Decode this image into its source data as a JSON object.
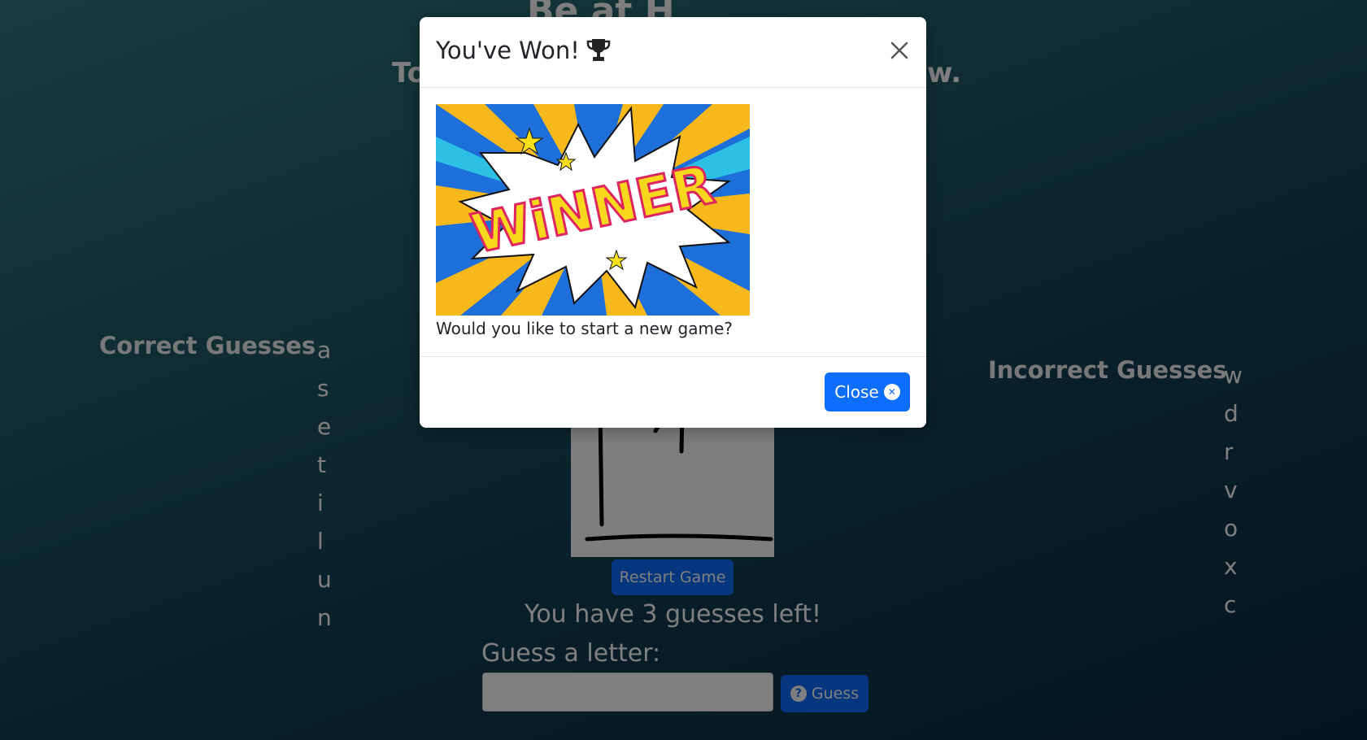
{
  "background": {
    "title_partial": "Be  at H",
    "subtitle_left": "To",
    "subtitle_right": "w.",
    "correct_heading": "Correct Guesses",
    "correct_letters": [
      "a",
      "s",
      "e",
      "t",
      "i",
      "l",
      "u",
      "n"
    ],
    "incorrect_heading": "Incorrect Guesses",
    "incorrect_letters": [
      "w",
      "d",
      "r",
      "v",
      "o",
      "x",
      "c"
    ],
    "restart_label": "Restart Game",
    "guesses_left": "You have 3 guesses left!",
    "guess_label": "Guess a letter:",
    "guess_input_value": "",
    "guess_button_label": "Guess"
  },
  "modal": {
    "title": "You've Won!",
    "trophy_icon": "trophy-icon",
    "close_icon": "close-icon",
    "image_text": "WiNNER",
    "body_text": "Would you like to start a new game?",
    "close_label": "Close"
  },
  "colors": {
    "accent": "#0d6efd"
  }
}
